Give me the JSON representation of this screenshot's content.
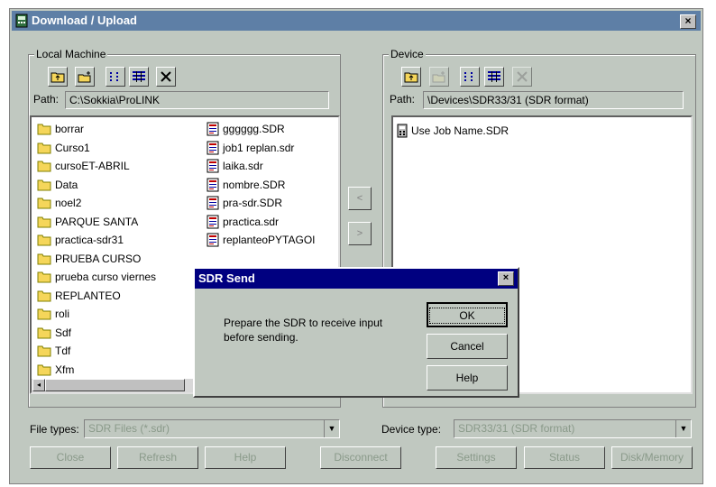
{
  "window": {
    "title": "Download / Upload",
    "close_label": "×"
  },
  "local": {
    "group_label": "Local Machine",
    "path_label": "Path:",
    "path_value": "C:\\Sokkia\\ProLINK",
    "folders": [
      "borrar",
      "Curso1",
      "cursoET-ABRIL",
      "Data",
      "noel2",
      "PARQUE SANTA",
      "practica-sdr31",
      "PRUEBA CURSO",
      "prueba curso viernes",
      "REPLANTEO",
      "roli",
      "Sdf",
      "Tdf",
      "Xfm"
    ],
    "files": [
      "gggggg.SDR",
      "job1  replan.sdr",
      "laika.sdr",
      "nombre.SDR",
      "pra-sdr.SDR",
      "practica.sdr",
      "replanteoPYTAGOI"
    ]
  },
  "device": {
    "group_label": "Device",
    "path_label": "Path:",
    "path_value": "\\Devices\\SDR33/31 (SDR format)",
    "items": [
      "Use Job Name.SDR"
    ]
  },
  "transfer": {
    "left_arrow": "<",
    "right_arrow": ">"
  },
  "filters": {
    "file_types_label": "File types:",
    "file_types_value": "SDR Files (*.sdr)",
    "device_type_label": "Device type:",
    "device_type_value": "SDR33/31 (SDR format)"
  },
  "buttons": {
    "close": "Close",
    "refresh": "Refresh",
    "help": "Help",
    "disconnect": "Disconnect",
    "settings": "Settings",
    "status": "Status",
    "disk_memory": "Disk/Memory"
  },
  "dialog": {
    "title": "SDR Send",
    "message": "Prepare the SDR to receive input before sending.",
    "ok": "OK",
    "cancel": "Cancel",
    "help": "Help",
    "close_label": "×"
  },
  "colors": {
    "window_bg": "#c0c8c0",
    "main_title_bg": "#5e7fa6",
    "dialog_title_bg": "#000080",
    "folder": "#f5d65a"
  }
}
